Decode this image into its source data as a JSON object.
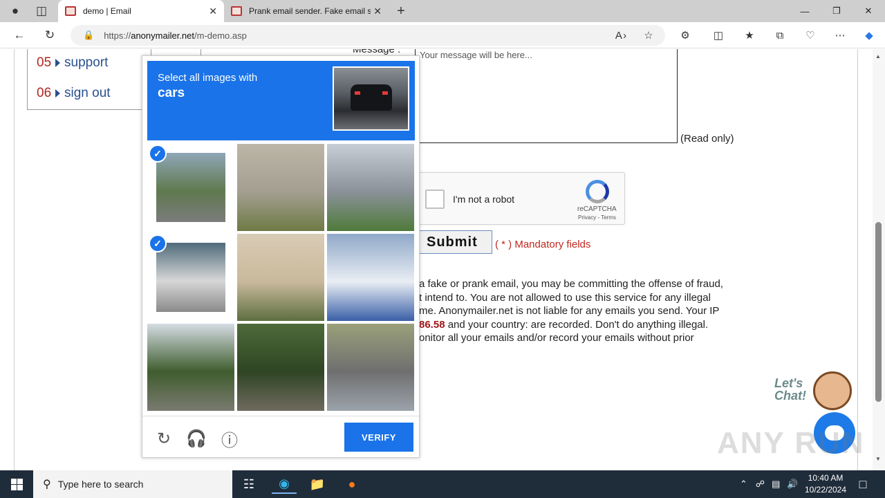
{
  "browser": {
    "tabs": [
      {
        "title": "demo | Email",
        "active": true
      },
      {
        "title": "Prank email sender. Fake email se",
        "active": false
      }
    ],
    "new_tab": "+",
    "url_prefix": "https://",
    "url_host": "anonymailer.net",
    "url_path": "/m-demo.asp",
    "window_buttons": {
      "minimize": "—",
      "restore": "❐",
      "close": "✕"
    }
  },
  "menu": {
    "items": [
      {
        "num": "05",
        "label": "support"
      },
      {
        "num": "06",
        "label": "sign out"
      }
    ]
  },
  "form": {
    "message_label": "Message :",
    "message_placeholder": "Your message will be here...",
    "read_only": "(Read only)",
    "recaptcha_label": "I'm not a robot",
    "recaptcha_brand": "reCAPTCHA",
    "recaptcha_terms": "Privacy - Terms",
    "submit": "Submit",
    "mandatory": "( * ) Mandatory fields",
    "warning": {
      "line1": "a fake or prank email, you may be committing the offense of fraud,",
      "line2": "t intend to. You are not allowed to use this service for any illegal",
      "line3": "me. Anonymailer.net is not liable for any emails you send. Your IP",
      "line4_ip": "86.58",
      "line4_rest": " and your country: are recorded. Don't do anything illegal.",
      "line5": "onitor all your emails and/or record your emails without prior"
    }
  },
  "chat": {
    "text_line1": "Let's",
    "text_line2": "Chat!"
  },
  "watermark": "ANY RUN",
  "captcha": {
    "instruction": "Select all images with",
    "target": "cars",
    "verify": "VERIFY",
    "check_mark": "✓",
    "icons": {
      "reload": "reload-icon",
      "audio": "headphones-icon",
      "info": "info-icon"
    },
    "tiles": [
      {
        "selected": true,
        "colors": [
          "#8fa6b8",
          "#5f7a4e",
          "#7b7b7b"
        ]
      },
      {
        "selected": false,
        "colors": [
          "#bdb6a8",
          "#a39f90",
          "#6e7a45"
        ]
      },
      {
        "selected": false,
        "colors": [
          "#c7ced6",
          "#8a9199",
          "#4f7a3a"
        ]
      },
      {
        "selected": true,
        "colors": [
          "#4f6b7a",
          "#d7d7d7",
          "#8a8a8a"
        ]
      },
      {
        "selected": false,
        "colors": [
          "#d9ccb5",
          "#c9b99c",
          "#5d6f3f"
        ]
      },
      {
        "selected": false,
        "colors": [
          "#8fa8c9",
          "#e9eef3",
          "#3a5fa8"
        ]
      },
      {
        "selected": false,
        "colors": [
          "#d5dce3",
          "#3f5d2e",
          "#7a7a70"
        ]
      },
      {
        "selected": false,
        "colors": [
          "#4e6a3a",
          "#2f4523",
          "#6f6a5f"
        ]
      },
      {
        "selected": false,
        "colors": [
          "#9aa07a",
          "#6f6f6f",
          "#9ca3ab"
        ]
      }
    ]
  },
  "taskbar": {
    "search_placeholder": "Type here to search",
    "time": "10:40 AM",
    "date": "10/22/2024"
  }
}
